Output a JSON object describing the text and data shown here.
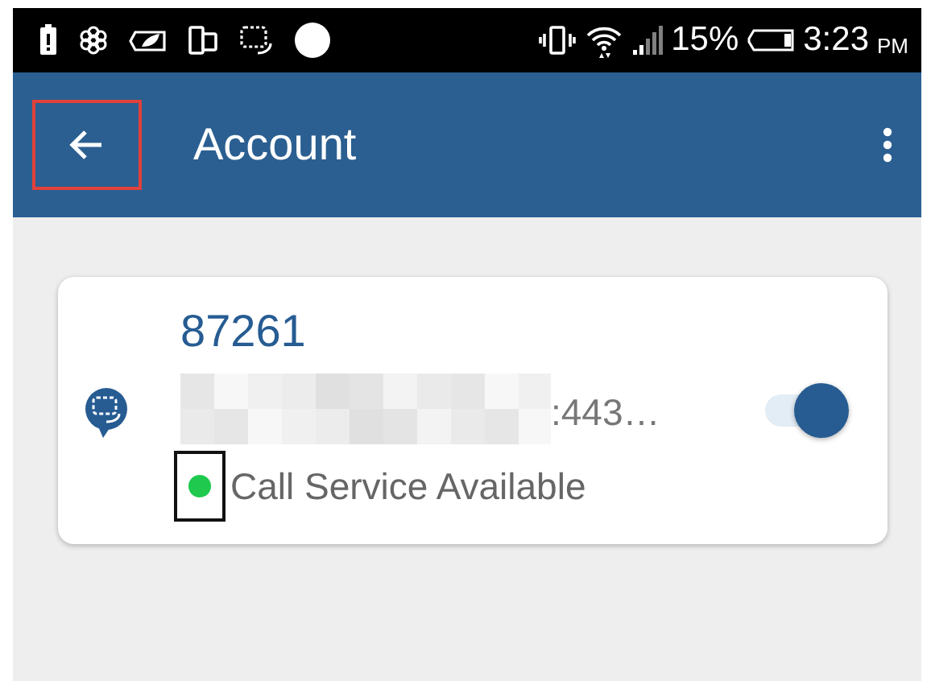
{
  "status_bar": {
    "battery_percent": "15%",
    "time": "3:23",
    "meridiem": "PM"
  },
  "toolbar": {
    "title": "Account",
    "back_highlighted": true
  },
  "account": {
    "number": "87261",
    "address_suffix": ":443…",
    "enabled": true,
    "status": {
      "text": "Call Service Available",
      "available": true,
      "highlighted": true
    }
  }
}
